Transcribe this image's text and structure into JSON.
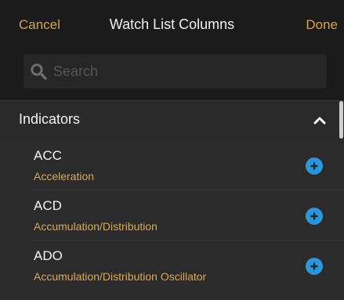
{
  "header": {
    "cancel_label": "Cancel",
    "title": "Watch List Columns",
    "done_label": "Done"
  },
  "search": {
    "placeholder": "Search",
    "value": ""
  },
  "section": {
    "title": "Indicators",
    "expanded": true
  },
  "items": [
    {
      "code": "ACC",
      "description": "Acceleration"
    },
    {
      "code": "ACD",
      "description": "Accumulation/Distribution"
    },
    {
      "code": "ADO",
      "description": "Accumulation/Distribution Oscillator"
    }
  ],
  "colors": {
    "accent": "#d8a255",
    "add_button": "#2f95d6",
    "header_bg": "#1b1b1b",
    "list_bg": "#2b2b2b"
  },
  "icons": {
    "search": "search-icon",
    "collapse": "chevron-up-icon",
    "add": "plus-circle-icon"
  }
}
